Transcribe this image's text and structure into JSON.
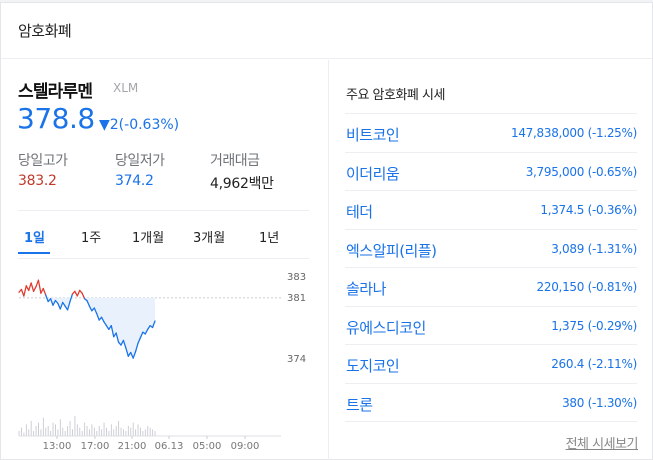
{
  "header": {
    "title": "암호화폐"
  },
  "coin": {
    "name": "스텔라루멘",
    "symbol": "XLM",
    "price": "378.8",
    "change": "▼2(-0.63%)",
    "stats": [
      {
        "label": "당일고가",
        "value": "383.2",
        "color": "#c0392b"
      },
      {
        "label": "당일저가",
        "value": "374.2",
        "color": "#1a73e8"
      },
      {
        "label": "거래대금",
        "value": "4,962백만",
        "color": "#222222"
      }
    ]
  },
  "tabs": [
    "1일",
    "1주",
    "1개월",
    "3개월",
    "1년"
  ],
  "chart_data": {
    "type": "line",
    "y_ticks": [
      "383",
      "381",
      "374"
    ],
    "x_ticks": [
      "13:00",
      "17:00",
      "21:00",
      "06.13",
      "05:00",
      "09:00"
    ],
    "reference_price": 381,
    "series": [
      {
        "values": [
          381.6,
          381.9,
          381.2,
          382.3,
          381.8,
          382.6,
          381.7,
          382.2,
          382.9,
          381.5,
          382.0,
          381.3,
          380.6,
          380.9,
          380.2,
          380.7,
          380.4,
          379.8,
          380.5,
          380.1,
          379.7,
          380.6,
          381.4,
          381.7,
          381.2,
          381.8,
          381.5,
          380.9,
          380.7,
          380.1,
          379.6,
          379.9,
          379.3,
          378.6,
          378.9,
          378.4,
          378.0,
          377.6,
          378.0,
          376.8,
          377.2,
          376.2,
          375.9,
          376.4,
          375.6,
          374.7,
          375.1,
          374.5,
          375.2,
          376.1,
          376.7,
          377.3,
          377.1,
          377.6,
          378.0,
          377.8,
          378.5
        ]
      }
    ],
    "volume": [
      3,
      5,
      2,
      7,
      4,
      9,
      3,
      6,
      8,
      4,
      11,
      5,
      6,
      3,
      8,
      7,
      4,
      10,
      5,
      3,
      6,
      9,
      4,
      12,
      7,
      5,
      3,
      8,
      6,
      4,
      7,
      5,
      3,
      6,
      4,
      8,
      5,
      3,
      7,
      4,
      6,
      9,
      5,
      4,
      3,
      6,
      5,
      8,
      4,
      7,
      5,
      3,
      4,
      6,
      5,
      4,
      3
    ]
  },
  "market": {
    "title": "주요 암호화폐 시세",
    "items": [
      {
        "name": "비트코인",
        "value": "147,838,000 (-1.25%)"
      },
      {
        "name": "이더리움",
        "value": "3,795,000 (-0.65%)"
      },
      {
        "name": "테더",
        "value": "1,374.5 (-0.36%)"
      },
      {
        "name": "엑스알피(리플)",
        "value": "3,089 (-1.31%)"
      },
      {
        "name": "솔라나",
        "value": "220,150 (-0.81%)"
      },
      {
        "name": "유에스디코인",
        "value": "1,375 (-0.29%)"
      },
      {
        "name": "도지코인",
        "value": "260.4 (-2.11%)"
      },
      {
        "name": "트론",
        "value": "380 (-1.30%)"
      }
    ],
    "more_label": "전체 시세보기"
  },
  "colors": {
    "up": "#e03c31",
    "down": "#1a73e8",
    "fill": "#e8f1fc"
  }
}
